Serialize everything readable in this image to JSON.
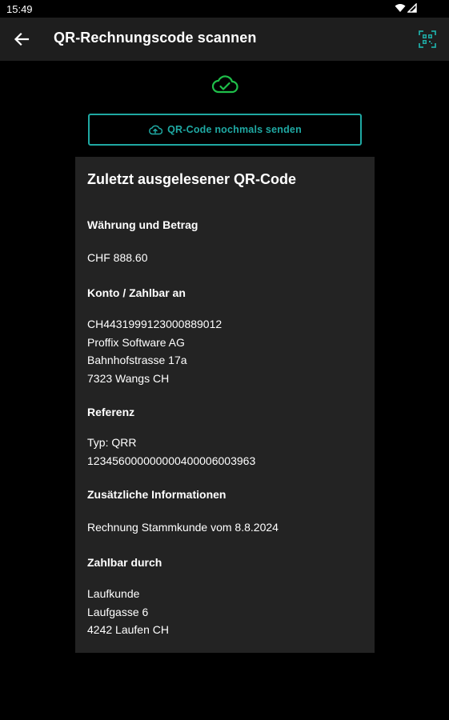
{
  "status_bar": {
    "time": "15:49",
    "icons": [
      "wifi-icon",
      "signal-icon"
    ]
  },
  "app_bar": {
    "title": "QR-Rechnungscode scannen",
    "back_icon": "arrow-back-icon",
    "action_icon": "qr-scan-icon"
  },
  "upload_status": {
    "icon": "cloud-check-icon",
    "color": "#1fbf4a"
  },
  "resend_button": {
    "label": "QR-Code nochmals senden",
    "icon": "cloud-upload-icon",
    "color": "#1fa9a3"
  },
  "card": {
    "title": "Zuletzt ausgelesener QR-Code",
    "sections": [
      {
        "heading": "Währung und Betrag",
        "lines": [
          "CHF 888.60"
        ]
      },
      {
        "heading": "Konto / Zahlbar an",
        "lines": [
          "CH4431999123000889012",
          "Proffix Software AG",
          "Bahnhofstrasse 17a",
          "7323 Wangs CH"
        ]
      },
      {
        "heading": "Referenz",
        "lines": [
          "Typ: QRR",
          "123456000000000400006003963"
        ]
      },
      {
        "heading": "Zusätzliche Informationen",
        "lines": [
          "Rechnung Stammkunde vom 8.8.2024"
        ]
      },
      {
        "heading": "Zahlbar durch",
        "lines": [
          "Laufkunde",
          "Laufgasse 6",
          "4242 Laufen CH"
        ]
      }
    ]
  }
}
